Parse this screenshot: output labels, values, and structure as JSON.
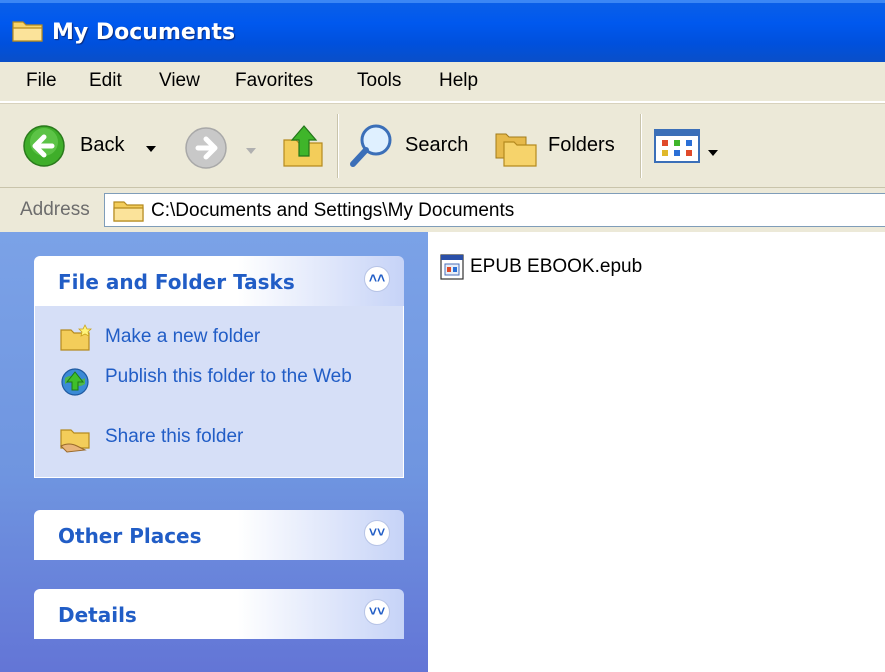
{
  "window": {
    "title": "My Documents"
  },
  "menu": [
    "File",
    "Edit",
    "View",
    "Favorites",
    "Tools",
    "Help"
  ],
  "toolbar": {
    "back_label": "Back",
    "search_label": "Search",
    "folders_label": "Folders"
  },
  "address": {
    "label": "Address",
    "value": "C:\\Documents and Settings\\My Documents"
  },
  "tasks_panel": {
    "title": "File and Folder Tasks",
    "items": [
      {
        "label": "Make a new folder",
        "icon": "new-folder-icon"
      },
      {
        "label": "Publish this folder to the Web",
        "icon": "publish-web-icon"
      },
      {
        "label": "Share this folder",
        "icon": "share-folder-icon"
      }
    ]
  },
  "other_places": {
    "title": "Other Places"
  },
  "details": {
    "title": "Details"
  },
  "files": [
    {
      "name": "EPUB EBOOK.epub",
      "icon": "epub-file-icon"
    }
  ],
  "colors": {
    "titlebar": "#0058ee",
    "chrome": "#ece9d8",
    "task_link": "#215dc6",
    "panel_bg": "#6f95e0"
  }
}
